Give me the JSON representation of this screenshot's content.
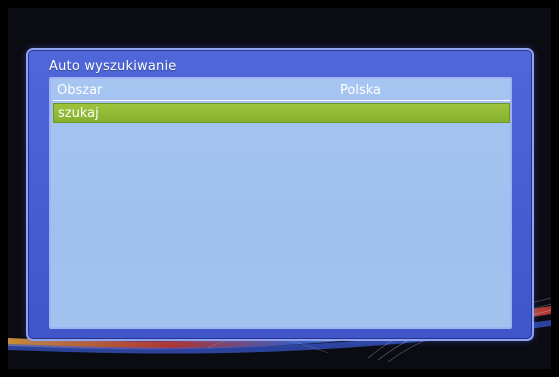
{
  "dialog": {
    "title": "Auto wyszukiwanie",
    "rows": [
      {
        "label": "Obszar",
        "value": "Polska"
      },
      {
        "label": "szukaj",
        "value": ""
      }
    ]
  },
  "colors": {
    "panel": "#4a61d4",
    "content": "#a4c3f0",
    "selection": "#8fbb34"
  }
}
